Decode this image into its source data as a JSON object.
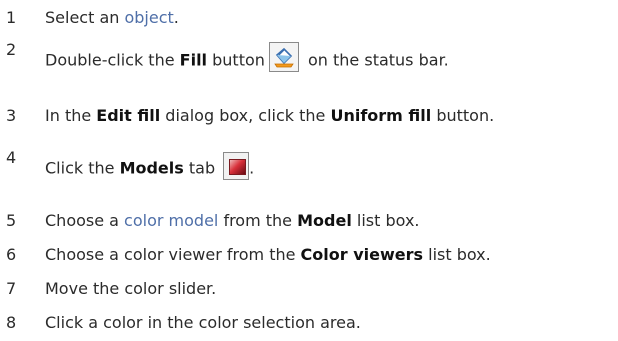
{
  "steps": [
    {
      "num": "1",
      "parts": [
        "Select an ",
        "object",
        "."
      ]
    },
    {
      "num": "2",
      "parts": [
        "Double-click the ",
        "Fill",
        " button",
        " on the status bar."
      ]
    },
    {
      "num": "3",
      "parts": [
        "In the ",
        "Edit fill",
        " dialog box, click the ",
        "Uniform fill",
        " button."
      ]
    },
    {
      "num": "4",
      "parts": [
        "Click the ",
        "Models",
        " tab",
        "."
      ]
    },
    {
      "num": "5",
      "parts": [
        "Choose a ",
        "color model",
        " from the ",
        "Model",
        " list box."
      ]
    },
    {
      "num": "6",
      "parts": [
        "Choose a color viewer from the ",
        "Color viewers",
        " list box."
      ]
    },
    {
      "num": "7",
      "parts": [
        "Move the color slider."
      ]
    },
    {
      "num": "8",
      "parts": [
        "Click a color in the color selection area."
      ]
    }
  ],
  "icons": {
    "fill_button": "paint-bucket-icon",
    "models_tab": "color-swatch-icon"
  },
  "colors": {
    "text": "#2b2b2b",
    "link": "#4f6fa8",
    "swatch": "#d8303a"
  }
}
